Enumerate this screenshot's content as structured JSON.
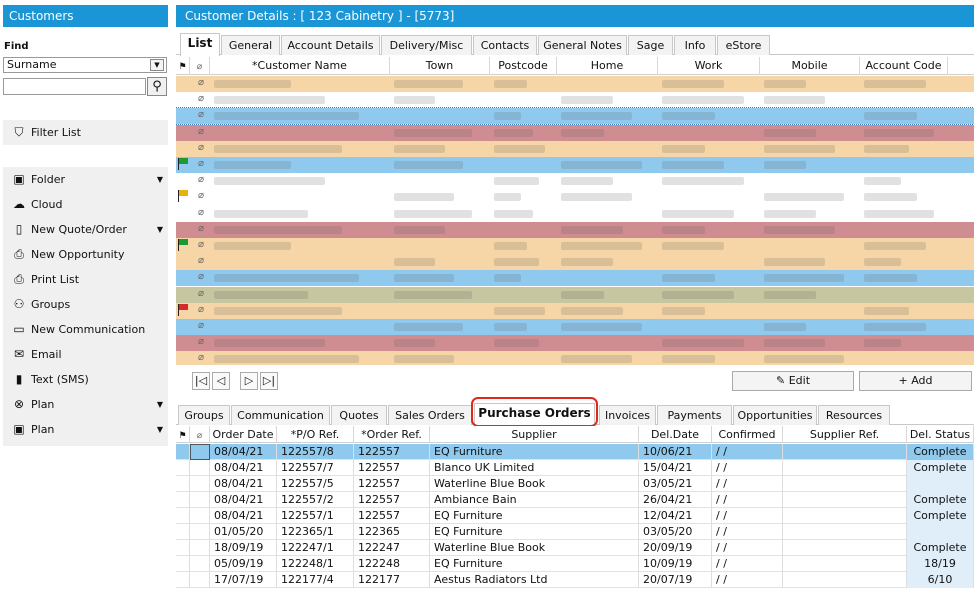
{
  "sidebar": {
    "title": "Customers",
    "find_label": "Find",
    "find_field": "Surname",
    "filter_label": "Filter List",
    "items": [
      {
        "label": "Folder",
        "icon": "folder-icon",
        "caret": true
      },
      {
        "label": "Cloud",
        "icon": "cloud-icon",
        "caret": false
      },
      {
        "label": "New Quote/Order",
        "icon": "document-icon",
        "caret": true
      },
      {
        "label": "New Opportunity",
        "icon": "opportunity-icon",
        "caret": false
      },
      {
        "label": "Print List",
        "icon": "printer-icon",
        "caret": false
      },
      {
        "label": "Groups",
        "icon": "groups-icon",
        "caret": false
      },
      {
        "label": "New Communication",
        "icon": "chat-icon",
        "caret": false
      },
      {
        "label": "Email",
        "icon": "email-icon",
        "caret": false
      },
      {
        "label": "Text (SMS)",
        "icon": "phone-icon",
        "caret": false
      },
      {
        "label": "Plan",
        "icon": "plan-icon",
        "caret": true
      },
      {
        "label": "Plan",
        "icon": "word-icon",
        "caret": true
      }
    ]
  },
  "header": {
    "title": "Customer Details : [ 123 Cabinetry ]  -  [5773]"
  },
  "top_tabs": [
    "List",
    "General",
    "Account Details",
    "Delivery/Misc",
    "Contacts",
    "General Notes",
    "Sage",
    "Info",
    "eStore"
  ],
  "customer_grid": {
    "columns": [
      "*Customer Name",
      "Town",
      "Postcode",
      "Home",
      "Work",
      "Mobile",
      "Account Code"
    ]
  },
  "actions": {
    "edit": "Edit",
    "add": "Add"
  },
  "bottom_tabs": [
    "Groups",
    "Communication",
    "Quotes",
    "Sales Orders",
    "Purchase Orders",
    "Invoices",
    "Payments",
    "Opportunities",
    "Resources"
  ],
  "purchase_grid": {
    "columns": [
      "Order Date",
      "*P/O Ref.",
      "*Order Ref.",
      "Supplier",
      "Del.Date",
      "Confirmed",
      "Supplier Ref.",
      "Del. Status"
    ],
    "rows": [
      {
        "date": "08/04/21",
        "po": "122557/8",
        "order": "122557",
        "supplier": "EQ Furniture",
        "del": "10/06/21",
        "confirmed": " /  /",
        "supref": "",
        "status": "Complete"
      },
      {
        "date": "08/04/21",
        "po": "122557/7",
        "order": "122557",
        "supplier": "Blanco UK Limited",
        "del": "15/04/21",
        "confirmed": " /  /",
        "supref": "",
        "status": "Complete"
      },
      {
        "date": "08/04/21",
        "po": "122557/5",
        "order": "122557",
        "supplier": "Waterline Blue Book",
        "del": "03/05/21",
        "confirmed": " /  /",
        "supref": "",
        "status": ""
      },
      {
        "date": "08/04/21",
        "po": "122557/2",
        "order": "122557",
        "supplier": "Ambiance Bain",
        "del": "26/04/21",
        "confirmed": " /  /",
        "supref": "",
        "status": "Complete"
      },
      {
        "date": "08/04/21",
        "po": "122557/1",
        "order": "122557",
        "supplier": "EQ Furniture",
        "del": "12/04/21",
        "confirmed": " /  /",
        "supref": "",
        "status": "Complete"
      },
      {
        "date": "01/05/20",
        "po": "122365/1",
        "order": "122365",
        "supplier": "EQ Furniture",
        "del": "03/05/20",
        "confirmed": " /  /",
        "supref": "",
        "status": ""
      },
      {
        "date": "18/09/19",
        "po": "122247/1",
        "order": "122247",
        "supplier": "Waterline Blue Book",
        "del": "20/09/19",
        "confirmed": " /  /",
        "supref": "",
        "status": "Complete"
      },
      {
        "date": "05/09/19",
        "po": "122248/1",
        "order": "122248",
        "supplier": "EQ Furniture",
        "del": "10/09/19",
        "confirmed": " /  /",
        "supref": "",
        "status": "18/19"
      },
      {
        "date": "17/07/19",
        "po": "122177/4",
        "order": "122177",
        "supplier": "Aestus Radiators Ltd",
        "del": "20/07/19",
        "confirmed": " /  /",
        "supref": "",
        "status": "6/10"
      }
    ]
  },
  "colors": {
    "accent": "#1a96d6",
    "row_peach": "#f6d6a6",
    "row_red": "#cf8d92",
    "row_blue": "#8fcaee",
    "row_olive": "#c6c6a0",
    "row_white": "#ffffff",
    "flag_green": "#1d9a2f",
    "flag_yellow": "#e8b10d",
    "flag_red": "#d62a2a",
    "circle_red": "#e0281c"
  }
}
